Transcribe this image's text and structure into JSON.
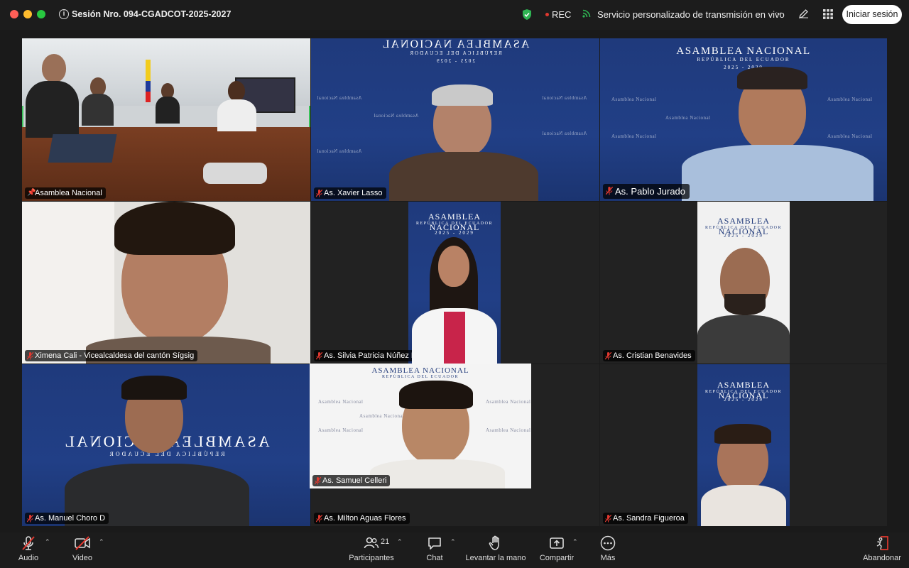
{
  "window": {
    "session_title": "Sesión Nro. 094-CGADCOT-2025-2027",
    "rec_label": "REC",
    "stream_label": "Servicio personalizado de transmisión en vivo",
    "signin_label": "Iniciar sesión"
  },
  "participants": [
    {
      "name": "Asamblea Nacional",
      "pinned": true,
      "active": true
    },
    {
      "name": "As. Xavier Lasso",
      "muted": true
    },
    {
      "name": "As. Pablo Jurado",
      "muted": true
    },
    {
      "name": "Ximena Cali - Vicealcaldesa del cantón Sígsig",
      "muted": true
    },
    {
      "name": "As. Silvia Patricia Núñez Ramos",
      "muted": true
    },
    {
      "name": "As. Cristian Benavides",
      "muted": true
    },
    {
      "name": "As. Manuel Choro D",
      "muted": true
    },
    {
      "name": "As. Milton Aguas Flores",
      "muted": true
    },
    {
      "name": "As. Sandra Figueroa",
      "muted": true
    },
    {
      "name": "As. Samuel Celleri",
      "muted": true
    }
  ],
  "backgrounds": {
    "banner_title": "Asamblea Nacional",
    "banner_subtitle": "República del Ecuador",
    "banner_years": "2025 - 2029",
    "banner_title_caps": "ASAMBLEA NACIONAL",
    "banner_subtitle_caps": "REPÚBLICA DEL ECUADOR"
  },
  "toolbar": {
    "audio_label": "Audio",
    "video_label": "Video",
    "participants_label": "Participantes",
    "participants_count": "21",
    "chat_label": "Chat",
    "raise_hand_label": "Levantar la mano",
    "share_label": "Compartir",
    "more_label": "Más",
    "leave_label": "Abandonar"
  },
  "colors": {
    "active_speaker": "#3ac15a",
    "rec": "#e0382f",
    "shield": "#2fb553",
    "stream": "#2fb553",
    "leave": "#e0382f",
    "assembly_blue": "#213f86"
  },
  "icons": [
    "info-icon",
    "shield-icon",
    "stream-icon",
    "pencil-icon",
    "grid-icon",
    "mic-off-icon",
    "video-off-icon",
    "participants-icon",
    "chat-icon",
    "hand-icon",
    "share-icon",
    "more-icon",
    "leave-icon",
    "pin-icon",
    "mute-icon"
  ]
}
